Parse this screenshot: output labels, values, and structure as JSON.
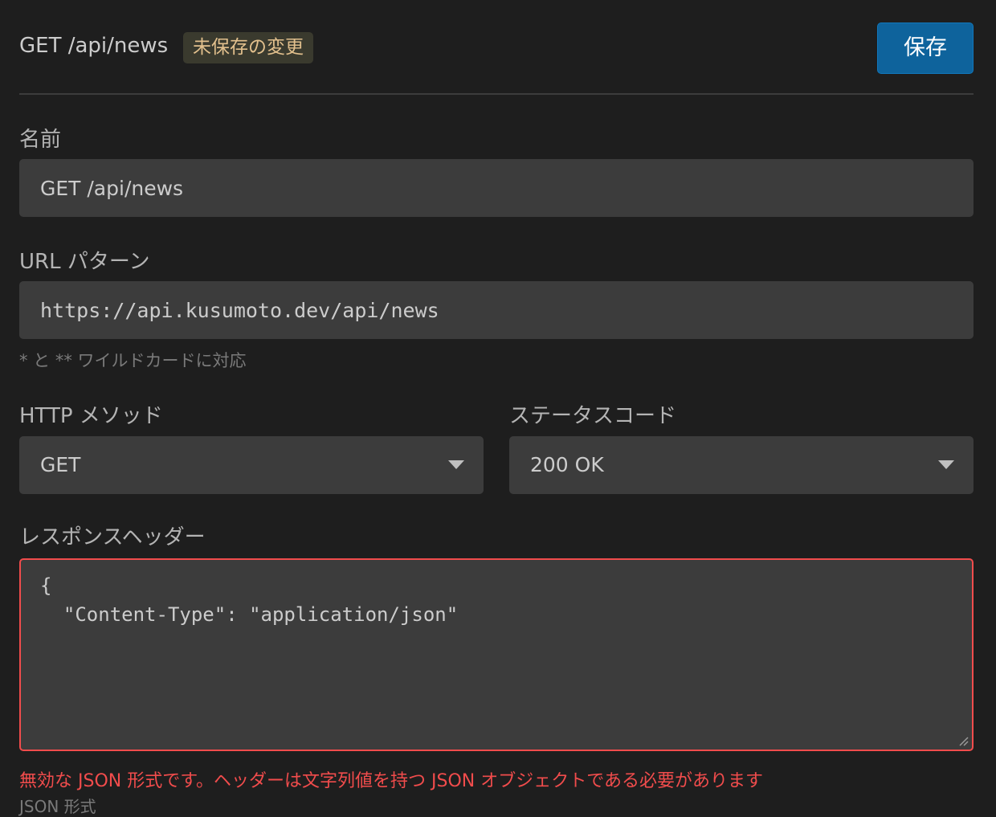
{
  "header": {
    "title": "GET /api/news",
    "unsaved_badge": "未保存の変更",
    "save_label": "保存"
  },
  "fields": {
    "name": {
      "label": "名前",
      "value": "GET /api/news"
    },
    "url_pattern": {
      "label": "URL パターン",
      "value": "https://api.kusumoto.dev/api/news",
      "hint": "* と ** ワイルドカードに対応"
    },
    "http_method": {
      "label": "HTTP メソッド",
      "selected": "GET"
    },
    "status_code": {
      "label": "ステータスコード",
      "selected": "200 OK"
    },
    "response_headers": {
      "label": "レスポンスヘッダー",
      "value": "{\n  \"Content-Type\": \"application/json\"",
      "error": "無効な JSON 形式です。ヘッダーは文字列値を持つ JSON オブジェクトである必要があります",
      "format_hint": "JSON 形式"
    }
  },
  "colors": {
    "background": "#1e1e1e",
    "input_background": "#3c3c3c",
    "accent": "#0e639c",
    "error": "#f14c4c",
    "badge_text": "#e2c08d"
  }
}
